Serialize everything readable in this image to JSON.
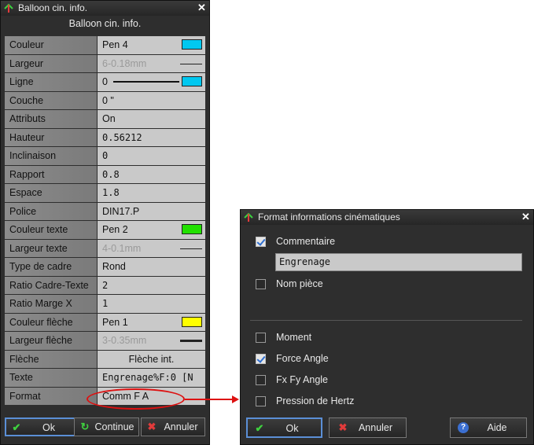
{
  "left_window": {
    "title": "Balloon cin. info.",
    "heading": "Balloon cin. info.",
    "rows": [
      {
        "label": "Couleur",
        "value": "Pen 4",
        "swatch": "#00c8f0"
      },
      {
        "label": "Largeur",
        "value": "6-0.18mm",
        "dim": true,
        "glyph": "line-thin"
      },
      {
        "label": "Ligne",
        "value": "0",
        "swatch": "#00c8f0",
        "glyph": "line-sample"
      },
      {
        "label": "Couche",
        "value": "0 \""
      },
      {
        "label": "Attributs",
        "value": "On"
      },
      {
        "label": "Hauteur",
        "value": "0.56212",
        "mono": true
      },
      {
        "label": "Inclinaison",
        "value": "0",
        "mono": true
      },
      {
        "label": "Rapport",
        "value": "0.8",
        "mono": true
      },
      {
        "label": "Espace",
        "value": "1.8",
        "mono": true
      },
      {
        "label": "Police",
        "value": "DIN17.P"
      },
      {
        "label": "Couleur texte",
        "value": "Pen 2",
        "swatch": "#22e000"
      },
      {
        "label": "Largeur texte",
        "value": "4-0.1mm",
        "dim": true,
        "glyph": "line-thin"
      },
      {
        "label": "Type de cadre",
        "value": "Rond"
      },
      {
        "label": "Ratio Cadre-Texte",
        "value": "2",
        "mono": true
      },
      {
        "label": "Ratio Marge X",
        "value": "1",
        "mono": true
      },
      {
        "label": "Couleur flèche",
        "value": "Pen 1",
        "swatch": "#ffff00"
      },
      {
        "label": "Largeur flèche",
        "value": "3-0.35mm",
        "dim": true,
        "glyph": "line-thick"
      },
      {
        "label": "Flèche",
        "value": "Flèche int.",
        "center": true
      },
      {
        "label": "Texte",
        "value": "Engrenage%F:0 [N",
        "mono": true
      },
      {
        "label": "Format",
        "value": "Comm F A"
      }
    ],
    "buttons": {
      "ok": "Ok",
      "continue": "Continue",
      "cancel": "Annuler"
    }
  },
  "right_window": {
    "title": "Format informations cinématiques",
    "checkboxes_top": [
      {
        "label": "Commentaire",
        "checked": true
      },
      {
        "label": "Nom pièce",
        "checked": false
      }
    ],
    "comment_value": "Engrenage",
    "checkboxes_bottom": [
      {
        "label": "Moment",
        "checked": false
      },
      {
        "label": "Force Angle",
        "checked": true
      },
      {
        "label": "Fx Fy Angle",
        "checked": false
      },
      {
        "label": "Pression de Hertz",
        "checked": false
      }
    ],
    "buttons": {
      "ok": "Ok",
      "cancel": "Annuler",
      "help": "Aide"
    }
  },
  "annotation_color": "#dd1111"
}
